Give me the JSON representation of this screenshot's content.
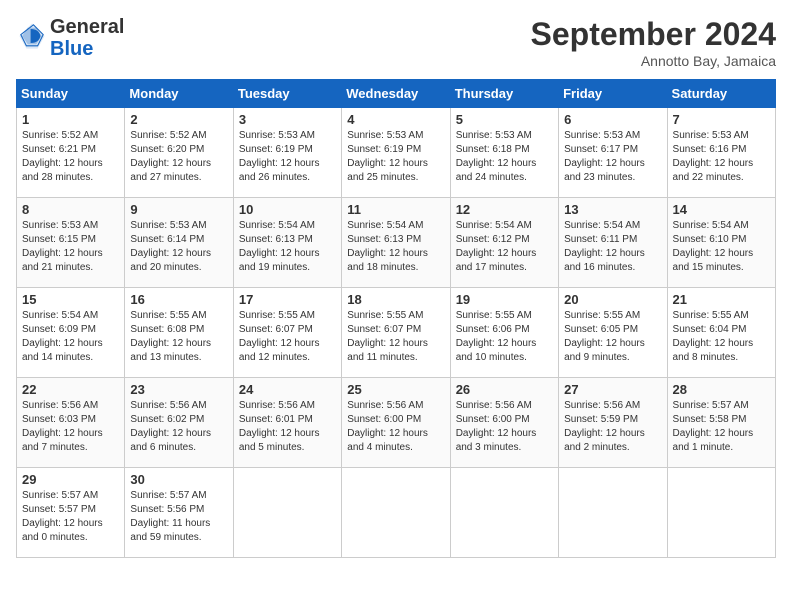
{
  "header": {
    "logo_line1": "General",
    "logo_line2": "Blue",
    "month": "September 2024",
    "location": "Annotto Bay, Jamaica"
  },
  "weekdays": [
    "Sunday",
    "Monday",
    "Tuesday",
    "Wednesday",
    "Thursday",
    "Friday",
    "Saturday"
  ],
  "weeks": [
    [
      {
        "day": "1",
        "info": "Sunrise: 5:52 AM\nSunset: 6:21 PM\nDaylight: 12 hours\nand 28 minutes."
      },
      {
        "day": "2",
        "info": "Sunrise: 5:52 AM\nSunset: 6:20 PM\nDaylight: 12 hours\nand 27 minutes."
      },
      {
        "day": "3",
        "info": "Sunrise: 5:53 AM\nSunset: 6:19 PM\nDaylight: 12 hours\nand 26 minutes."
      },
      {
        "day": "4",
        "info": "Sunrise: 5:53 AM\nSunset: 6:19 PM\nDaylight: 12 hours\nand 25 minutes."
      },
      {
        "day": "5",
        "info": "Sunrise: 5:53 AM\nSunset: 6:18 PM\nDaylight: 12 hours\nand 24 minutes."
      },
      {
        "day": "6",
        "info": "Sunrise: 5:53 AM\nSunset: 6:17 PM\nDaylight: 12 hours\nand 23 minutes."
      },
      {
        "day": "7",
        "info": "Sunrise: 5:53 AM\nSunset: 6:16 PM\nDaylight: 12 hours\nand 22 minutes."
      }
    ],
    [
      {
        "day": "8",
        "info": "Sunrise: 5:53 AM\nSunset: 6:15 PM\nDaylight: 12 hours\nand 21 minutes."
      },
      {
        "day": "9",
        "info": "Sunrise: 5:53 AM\nSunset: 6:14 PM\nDaylight: 12 hours\nand 20 minutes."
      },
      {
        "day": "10",
        "info": "Sunrise: 5:54 AM\nSunset: 6:13 PM\nDaylight: 12 hours\nand 19 minutes."
      },
      {
        "day": "11",
        "info": "Sunrise: 5:54 AM\nSunset: 6:13 PM\nDaylight: 12 hours\nand 18 minutes."
      },
      {
        "day": "12",
        "info": "Sunrise: 5:54 AM\nSunset: 6:12 PM\nDaylight: 12 hours\nand 17 minutes."
      },
      {
        "day": "13",
        "info": "Sunrise: 5:54 AM\nSunset: 6:11 PM\nDaylight: 12 hours\nand 16 minutes."
      },
      {
        "day": "14",
        "info": "Sunrise: 5:54 AM\nSunset: 6:10 PM\nDaylight: 12 hours\nand 15 minutes."
      }
    ],
    [
      {
        "day": "15",
        "info": "Sunrise: 5:54 AM\nSunset: 6:09 PM\nDaylight: 12 hours\nand 14 minutes."
      },
      {
        "day": "16",
        "info": "Sunrise: 5:55 AM\nSunset: 6:08 PM\nDaylight: 12 hours\nand 13 minutes."
      },
      {
        "day": "17",
        "info": "Sunrise: 5:55 AM\nSunset: 6:07 PM\nDaylight: 12 hours\nand 12 minutes."
      },
      {
        "day": "18",
        "info": "Sunrise: 5:55 AM\nSunset: 6:07 PM\nDaylight: 12 hours\nand 11 minutes."
      },
      {
        "day": "19",
        "info": "Sunrise: 5:55 AM\nSunset: 6:06 PM\nDaylight: 12 hours\nand 10 minutes."
      },
      {
        "day": "20",
        "info": "Sunrise: 5:55 AM\nSunset: 6:05 PM\nDaylight: 12 hours\nand 9 minutes."
      },
      {
        "day": "21",
        "info": "Sunrise: 5:55 AM\nSunset: 6:04 PM\nDaylight: 12 hours\nand 8 minutes."
      }
    ],
    [
      {
        "day": "22",
        "info": "Sunrise: 5:56 AM\nSunset: 6:03 PM\nDaylight: 12 hours\nand 7 minutes."
      },
      {
        "day": "23",
        "info": "Sunrise: 5:56 AM\nSunset: 6:02 PM\nDaylight: 12 hours\nand 6 minutes."
      },
      {
        "day": "24",
        "info": "Sunrise: 5:56 AM\nSunset: 6:01 PM\nDaylight: 12 hours\nand 5 minutes."
      },
      {
        "day": "25",
        "info": "Sunrise: 5:56 AM\nSunset: 6:00 PM\nDaylight: 12 hours\nand 4 minutes."
      },
      {
        "day": "26",
        "info": "Sunrise: 5:56 AM\nSunset: 6:00 PM\nDaylight: 12 hours\nand 3 minutes."
      },
      {
        "day": "27",
        "info": "Sunrise: 5:56 AM\nSunset: 5:59 PM\nDaylight: 12 hours\nand 2 minutes."
      },
      {
        "day": "28",
        "info": "Sunrise: 5:57 AM\nSunset: 5:58 PM\nDaylight: 12 hours\nand 1 minute."
      }
    ],
    [
      {
        "day": "29",
        "info": "Sunrise: 5:57 AM\nSunset: 5:57 PM\nDaylight: 12 hours\nand 0 minutes."
      },
      {
        "day": "30",
        "info": "Sunrise: 5:57 AM\nSunset: 5:56 PM\nDaylight: 11 hours\nand 59 minutes."
      },
      {
        "day": "",
        "info": ""
      },
      {
        "day": "",
        "info": ""
      },
      {
        "day": "",
        "info": ""
      },
      {
        "day": "",
        "info": ""
      },
      {
        "day": "",
        "info": ""
      }
    ]
  ]
}
